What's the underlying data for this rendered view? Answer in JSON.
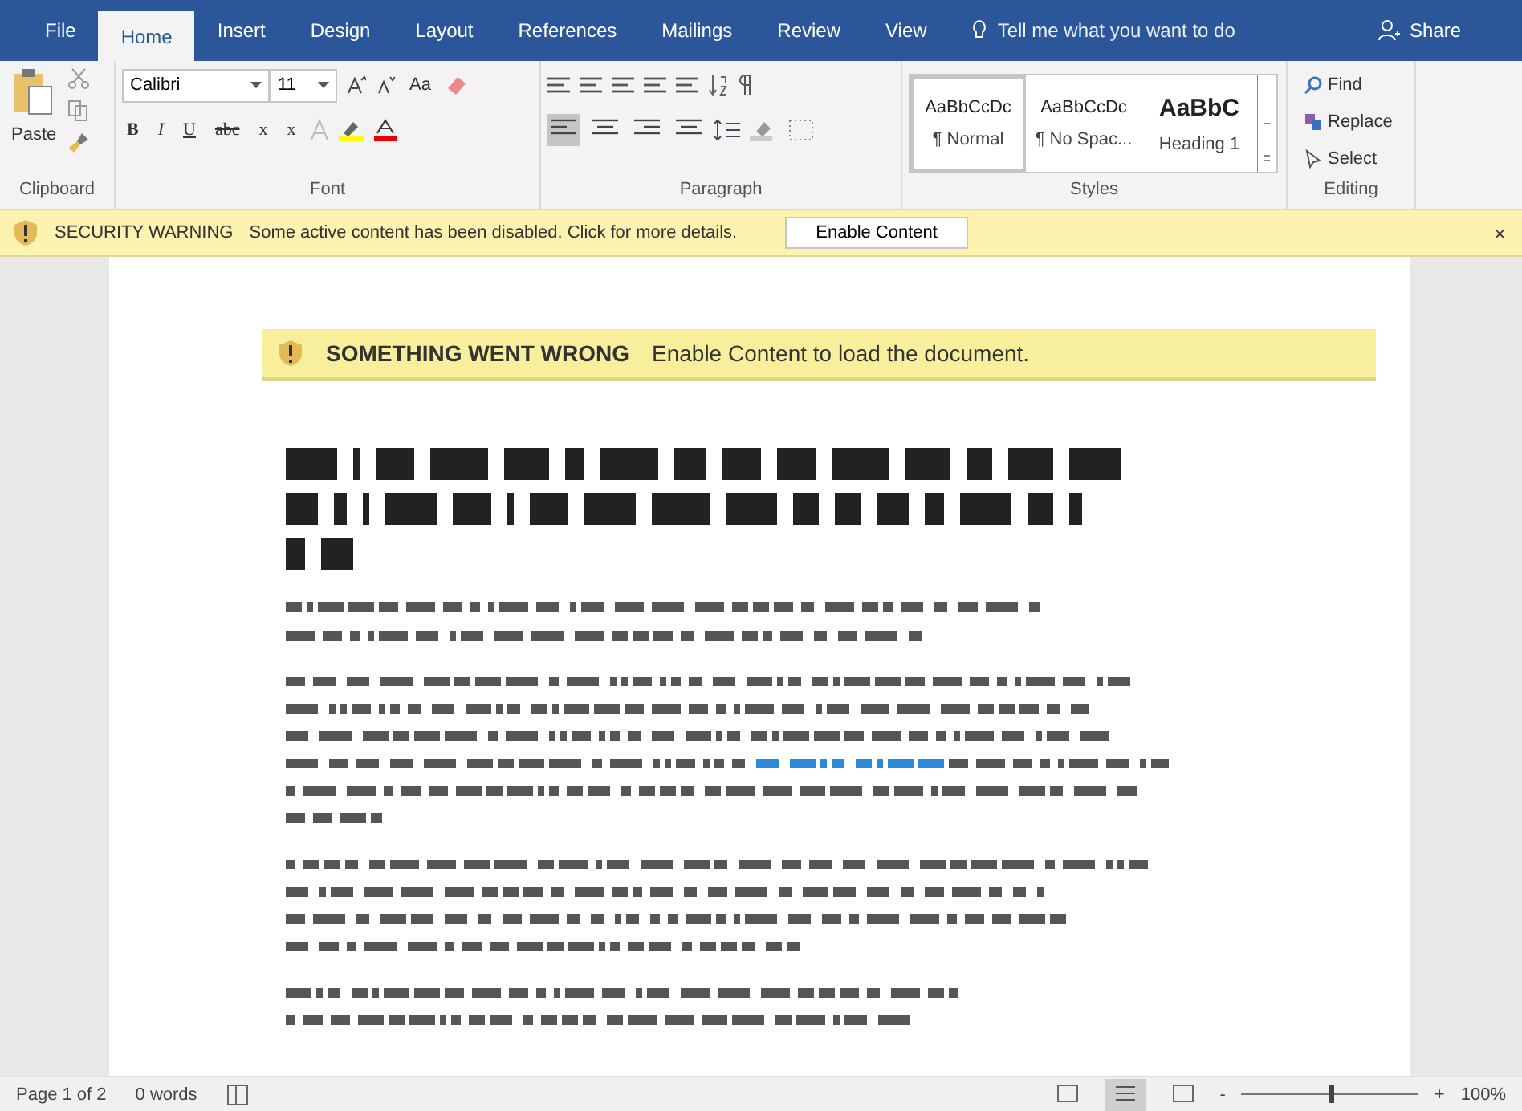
{
  "tabs": [
    {
      "label": "File",
      "selected": false
    },
    {
      "label": "Home",
      "selected": true
    },
    {
      "label": "Insert",
      "selected": false
    },
    {
      "label": "Design",
      "selected": false
    },
    {
      "label": "Layout",
      "selected": false
    },
    {
      "label": "References",
      "selected": false
    },
    {
      "label": "Mailings",
      "selected": false
    },
    {
      "label": "Review",
      "selected": false
    },
    {
      "label": "View",
      "selected": false
    }
  ],
  "tell_me": "Tell me what you want to do",
  "share": "Share",
  "clipboard": {
    "paste": "Paste",
    "label": "Clipboard"
  },
  "font": {
    "name": "Calibri",
    "size": "11",
    "case": "Aa",
    "format_buttons": [
      "B",
      "I",
      "U",
      "abc",
      "x",
      "x"
    ],
    "label": "Font"
  },
  "paragraph": {
    "label": "Paragraph",
    "align": [
      {
        "selected": true
      },
      {
        "selected": false
      },
      {
        "selected": false
      },
      {
        "selected": false
      }
    ]
  },
  "styles": {
    "label": "Styles",
    "items": [
      {
        "preview": "AaBbCcDc",
        "name": "¶ Normal",
        "selected": true,
        "kind": "normal"
      },
      {
        "preview": "AaBbCcDc",
        "name": "¶ No Spac...",
        "selected": false,
        "kind": "normal"
      },
      {
        "preview": "AaBbC",
        "name": "Heading 1",
        "selected": false,
        "kind": "heading"
      }
    ]
  },
  "editing": {
    "label": "Editing",
    "items": [
      "Find",
      "Replace",
      "Select"
    ]
  },
  "security_bar": {
    "title": "SECURITY WARNING",
    "message": "Some active content has been disabled. Click for more details.",
    "button": "Enable Content",
    "close": "×"
  },
  "document": {
    "banner_title": "SOMETHING WENT WRONG",
    "banner_message": "Enable Content to load the document."
  },
  "status_bar": {
    "page": "Page 1 of 2",
    "words": "0 words",
    "zoom": "100%",
    "zoom_out": "-",
    "zoom_in": "+",
    "zoom_slider": {
      "level": 0.5
    }
  }
}
